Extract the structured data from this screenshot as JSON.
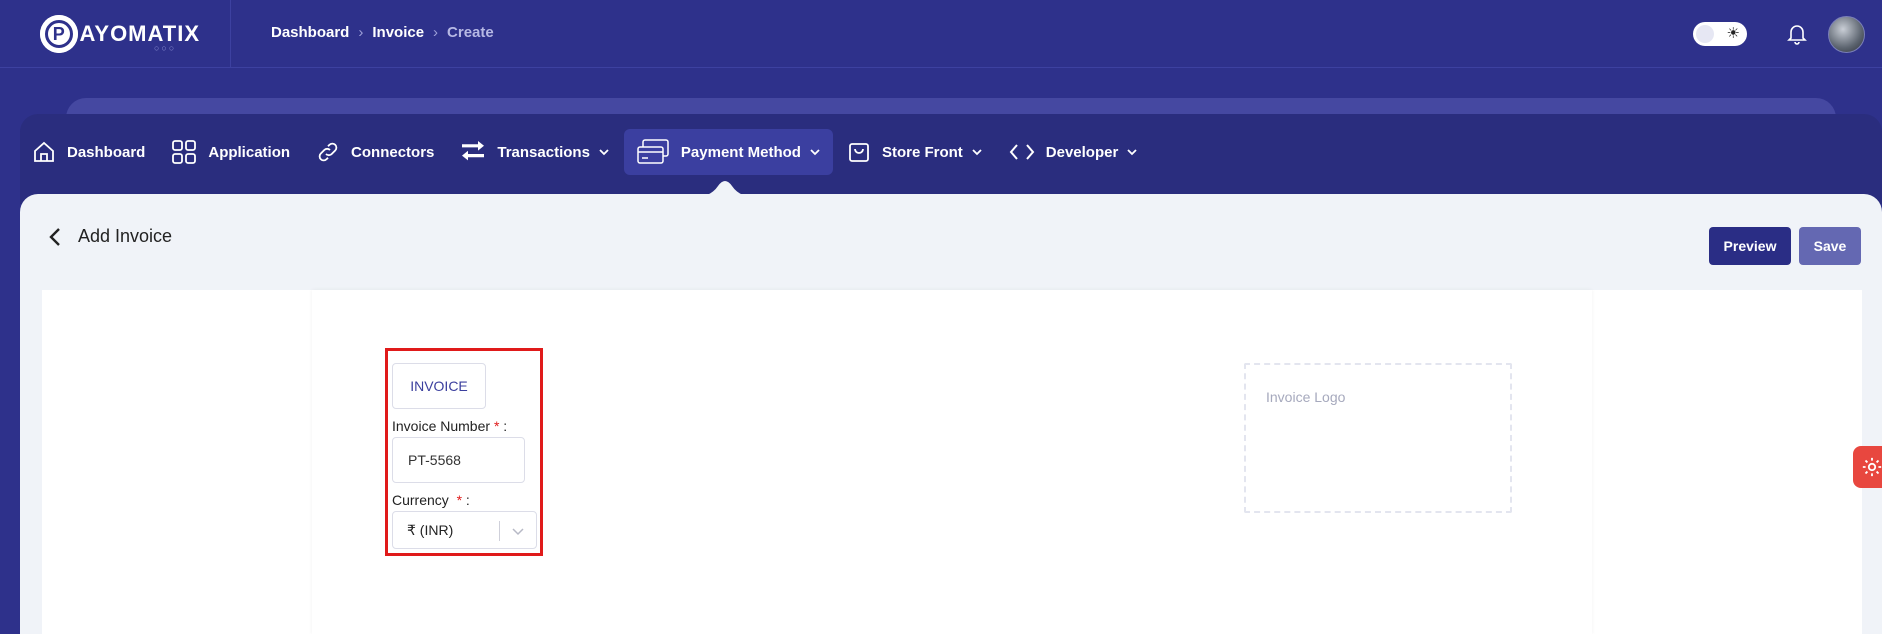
{
  "app": {
    "logo_initial": "P",
    "logo_text": "AYOMATIX",
    "logo_dots": "○○○"
  },
  "breadcrumb": [
    "Dashboard",
    "Invoice",
    "Create"
  ],
  "nav": {
    "items": [
      {
        "label": "Dashboard",
        "icon": "home-icon",
        "dropdown": false
      },
      {
        "label": "Application",
        "icon": "grid-icon",
        "dropdown": false
      },
      {
        "label": "Connectors",
        "icon": "link-icon",
        "dropdown": false
      },
      {
        "label": "Transactions",
        "icon": "transfer-icon",
        "dropdown": true
      },
      {
        "label": "Payment Method",
        "icon": "cards-icon",
        "dropdown": true,
        "active": true
      },
      {
        "label": "Store Front",
        "icon": "bag-icon",
        "dropdown": true
      },
      {
        "label": "Developer",
        "icon": "code-icon",
        "dropdown": true
      }
    ]
  },
  "page": {
    "title": "Add Invoice",
    "preview_label": "Preview",
    "save_label": "Save"
  },
  "form": {
    "invoice_label": "INVOICE",
    "invoice_number_label": "Invoice Number",
    "invoice_number_value": "PT-5568",
    "currency_label": "Currency",
    "currency_value": "₹ (INR)",
    "required_mark": "*",
    "label_suffix": ":",
    "logo_placeholder": "Invoice Logo"
  },
  "colors": {
    "brand": "#2e318b",
    "nav_bg": "#2a2d7e",
    "active_nav": "#3b3fa0",
    "preview_button": "#2a2d85",
    "save_button": "#6468b2",
    "required": "#e01a1a",
    "highlight_border": "#e01a1a",
    "settings_tab": "#e8473f"
  }
}
